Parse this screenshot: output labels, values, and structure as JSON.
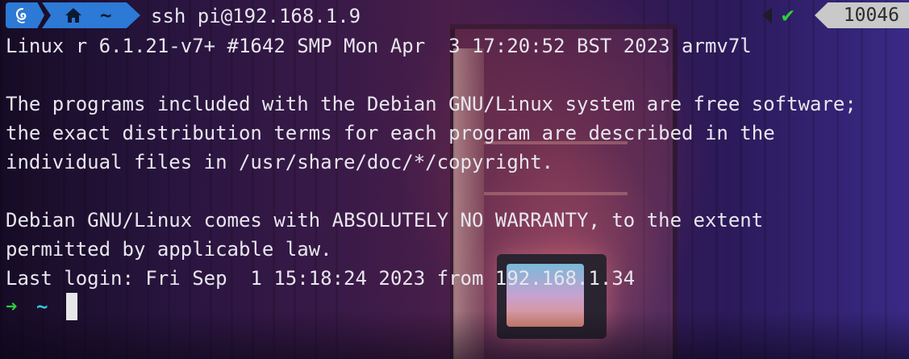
{
  "prompt_bar": {
    "os_icon": "debian-logo-icon",
    "home_icon": "home-icon",
    "directory": "~",
    "command": "ssh pi@192.168.1.9",
    "status_icon": "checkmark-icon",
    "history_number": "10046"
  },
  "output": {
    "lines": [
      "Linux r 6.1.21-v7+ #1642 SMP Mon Apr  3 17:20:52 BST 2023 armv7l",
      "",
      "The programs included with the Debian GNU/Linux system are free software;",
      "the exact distribution terms for each program are described in the",
      "individual files in /usr/share/doc/*/copyright.",
      "",
      "Debian GNU/Linux comes with ABSOLUTELY NO WARRANTY, to the extent",
      "permitted by applicable law.",
      "Last login: Fri Sep  1 15:18:24 2023 from 192.168.1.34"
    ]
  },
  "input_prompt": {
    "arrow": "➜",
    "directory": "~"
  },
  "colors": {
    "segment_blue": "#2c79d6",
    "success_green": "#2fcf3b",
    "path_cyan": "#35c7d6",
    "text": "#e8e6ee",
    "count_bg": "#c9c9c9"
  }
}
